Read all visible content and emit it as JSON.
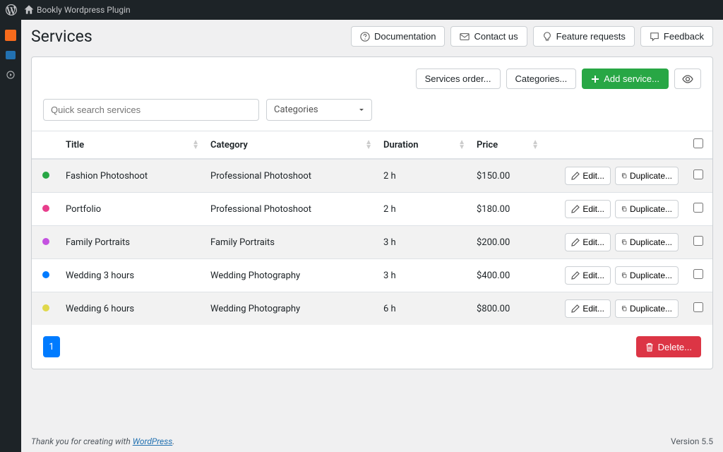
{
  "adminbar": {
    "site_title": "Bookly Wordpress Plugin"
  },
  "page": {
    "title": "Services"
  },
  "top_buttons": {
    "documentation": "Documentation",
    "contact": "Contact us",
    "feature": "Feature requests",
    "feedback": "Feedback"
  },
  "toolbar": {
    "services_order": "Services order...",
    "categories": "Categories...",
    "add_service": "Add service..."
  },
  "filters": {
    "search_placeholder": "Quick search services",
    "category_placeholder": "Categories"
  },
  "table": {
    "headers": {
      "title": "Title",
      "category": "Category",
      "duration": "Duration",
      "price": "Price"
    },
    "actions": {
      "edit": "Edit...",
      "duplicate": "Duplicate..."
    },
    "rows": [
      {
        "color": "#28a745",
        "title": "Fashion Photoshoot",
        "category": "Professional Photoshoot",
        "duration": "2 h",
        "price": "$150.00"
      },
      {
        "color": "#e83e8c",
        "title": "Portfolio",
        "category": "Professional Photoshoot",
        "duration": "2 h",
        "price": "$180.00"
      },
      {
        "color": "#c452e0",
        "title": "Family Portraits",
        "category": "Family Portraits",
        "duration": "3 h",
        "price": "$200.00"
      },
      {
        "color": "#007bff",
        "title": "Wedding 3 hours",
        "category": "Wedding Photography",
        "duration": "3 h",
        "price": "$400.00"
      },
      {
        "color": "#e0d84b",
        "title": "Wedding 6 hours",
        "category": "Wedding Photography",
        "duration": "6 h",
        "price": "$800.00"
      }
    ]
  },
  "pagination": {
    "current": "1"
  },
  "delete_label": "Delete...",
  "footer": {
    "thank_you": "Thank you for creating with ",
    "wp": "WordPress",
    "version": "Version 5.5"
  }
}
